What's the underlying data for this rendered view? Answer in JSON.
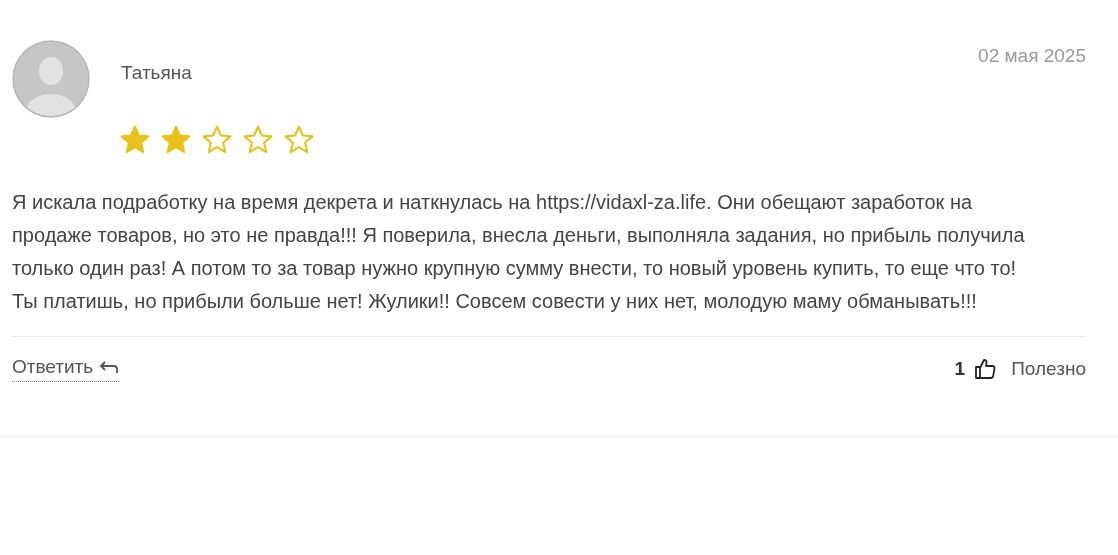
{
  "review": {
    "author": "Татьяна",
    "date": "02 мая 2025",
    "stars": 2,
    "text": "Я искала подработку на время декрета и наткнулась на https://vidaxl-za.life. Они обещают заработок на продаже товаров, но это не правда!!! Я поверила, внесла деньги, выполняла задания, но прибыль получила только один раз! А потом то за товар нужно крупную сумму внести, то новый уровень купить, то еще что то! Ты платишь, но прибыли больше нет! Жулики!! Совсем совести у них нет, молодую маму обманывать!!!",
    "reply": "Ответить",
    "likes": "1",
    "helpful": "Полезно"
  }
}
